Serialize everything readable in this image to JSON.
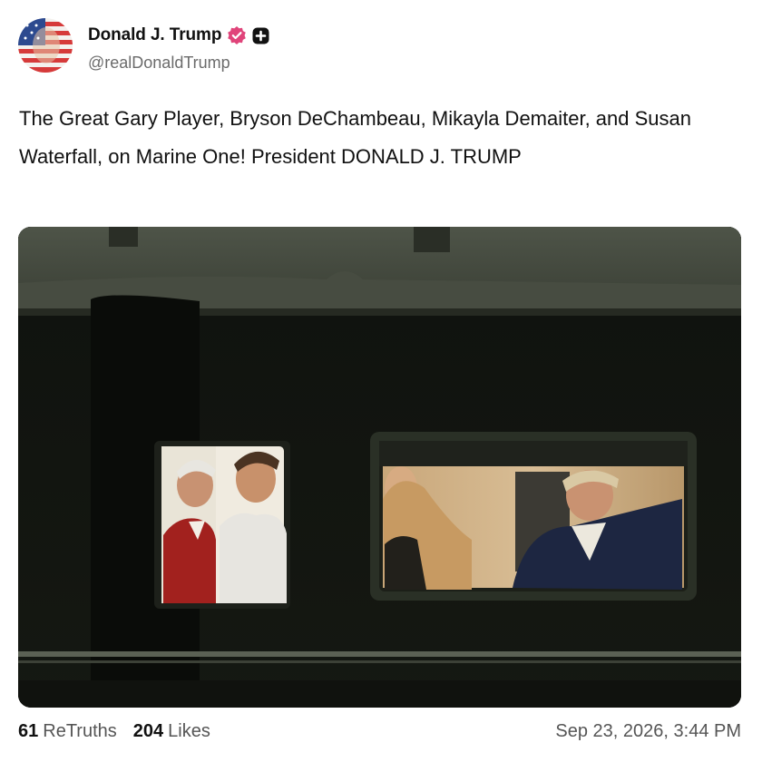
{
  "author": {
    "display_name": "Donald J. Trump",
    "handle": "@realDonaldTrump",
    "avatar_icon": "flag-portrait-avatar",
    "verified_icon": "verified-badge-icon",
    "verified_color": "#e0447a",
    "plus_icon": "plus-badge-icon"
  },
  "post": {
    "text": "The Great Gary Player, Bryson DeChambeau, Mikayla Demaiter, and Susan Waterfall, on Marine One! President DONALD J. TRUMP"
  },
  "media": {
    "type": "photo",
    "subject": "helicopter-windows-night"
  },
  "stats": {
    "retruths_count": "61",
    "retruths_label": "ReTruths",
    "likes_count": "204",
    "likes_label": "Likes"
  },
  "timestamp": "Sep 23, 2026, 3:44 PM"
}
